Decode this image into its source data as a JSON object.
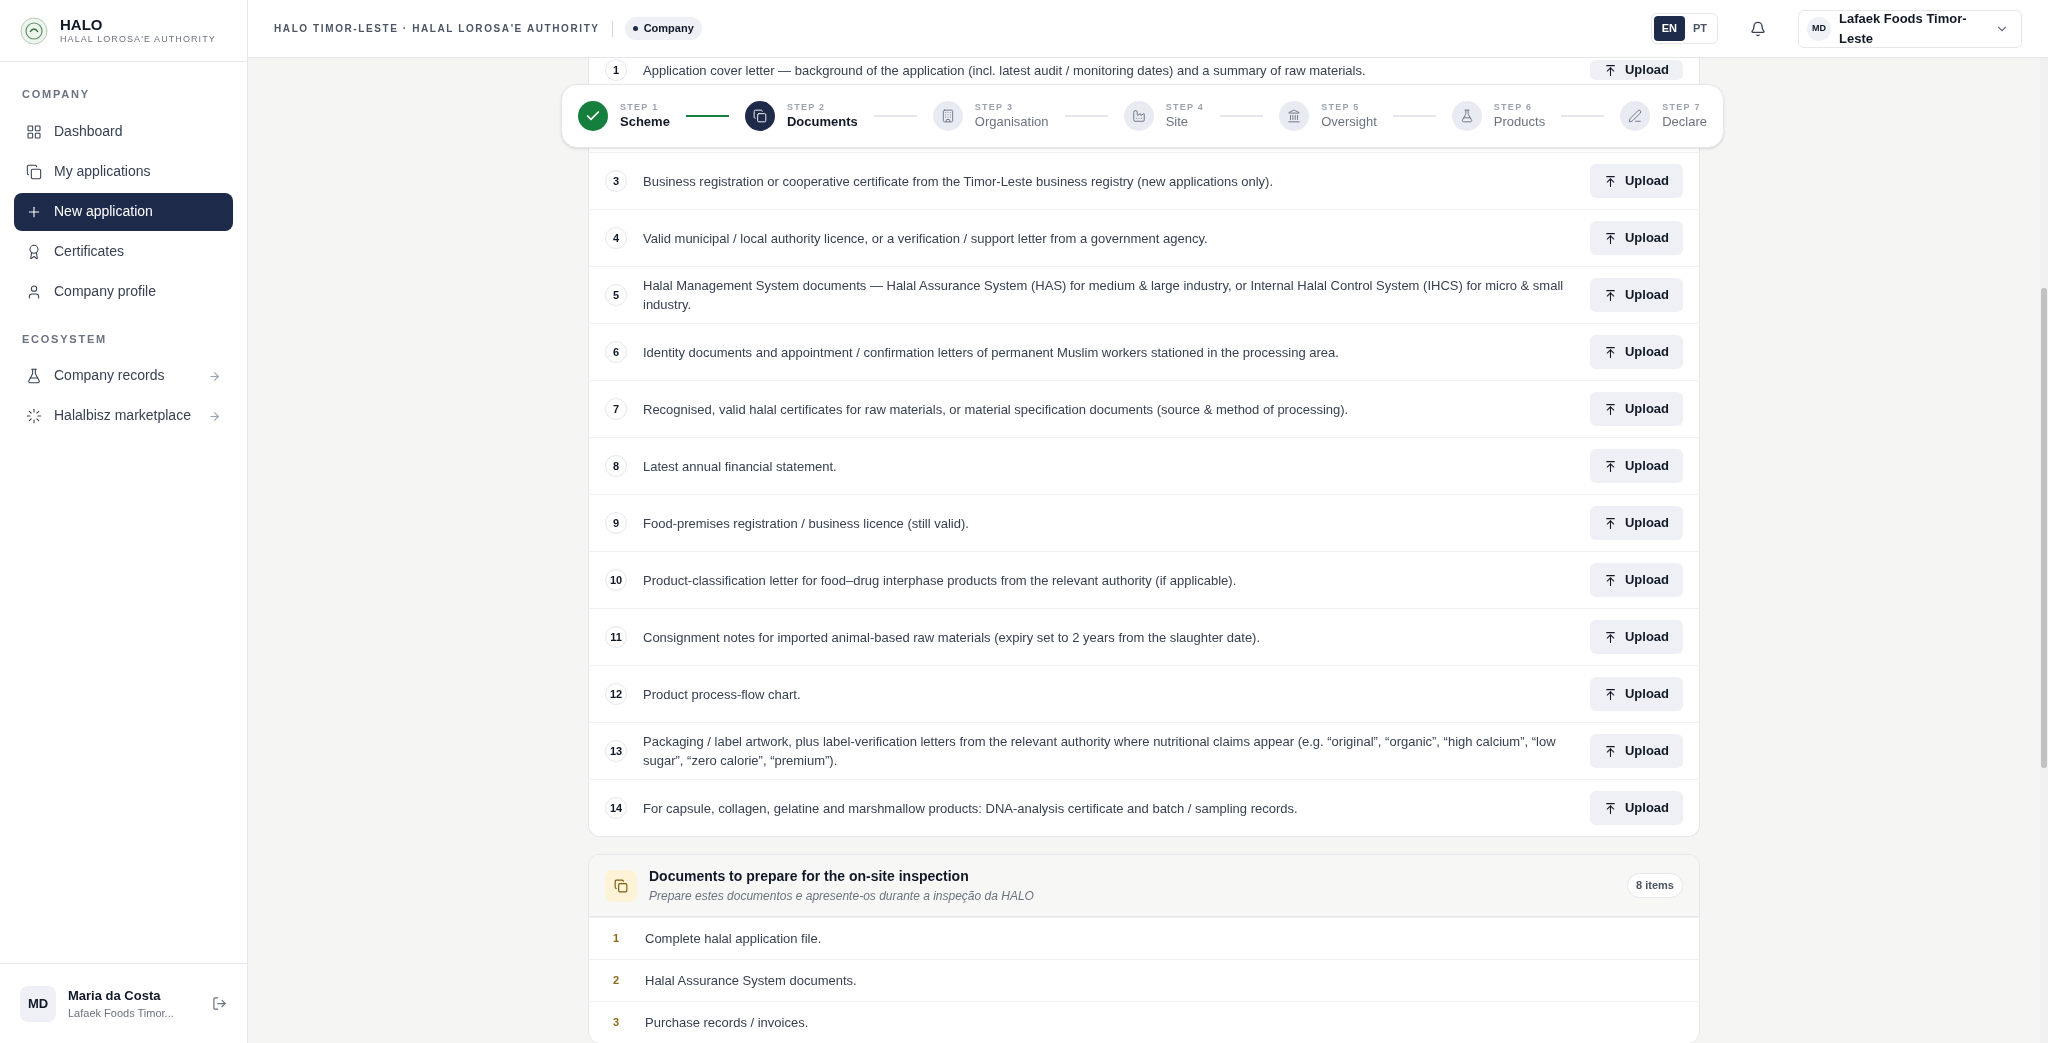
{
  "brand": {
    "title": "HALO",
    "subtitle": "HALAL LOROSA'E AUTHORITY"
  },
  "sidebar": {
    "sections": [
      {
        "heading": "COMPANY",
        "items": [
          {
            "label": "Dashboard",
            "selected": false
          },
          {
            "label": "My applications",
            "selected": false
          },
          {
            "label": "New application",
            "selected": true
          },
          {
            "label": "Certificates",
            "selected": false
          },
          {
            "label": "Company profile",
            "selected": false
          }
        ]
      },
      {
        "heading": "ECOSYSTEM",
        "items": [
          {
            "label": "Company records",
            "selected": false
          },
          {
            "label": "Halalbisz marketplace",
            "selected": false
          }
        ]
      }
    ]
  },
  "user": {
    "initials": "MD",
    "name": "Maria da Costa",
    "company": "Lafaek Foods Timor..."
  },
  "header": {
    "breadcrumb": "HALO TIMOR-LESTE · HALAL LOROSA'E AUTHORITY",
    "context_badge": "Company",
    "languages": [
      {
        "code": "EN",
        "selected": true
      },
      {
        "code": "PT",
        "selected": false
      }
    ],
    "account": {
      "initials": "MD",
      "name": "Lafaek Foods Timor-Leste"
    }
  },
  "steps": [
    {
      "label": "STEP 1",
      "name": "Scheme",
      "completed": true,
      "current": false
    },
    {
      "label": "STEP 2",
      "name": "Documents",
      "completed": false,
      "current": true
    },
    {
      "label": "STEP 3",
      "name": "Organisation",
      "completed": false,
      "current": false
    },
    {
      "label": "STEP 4",
      "name": "Site",
      "completed": false,
      "current": false
    },
    {
      "label": "STEP 5",
      "name": "Oversight",
      "completed": false,
      "current": false
    },
    {
      "label": "STEP 6",
      "name": "Products",
      "completed": false,
      "current": false
    },
    {
      "label": "STEP 7",
      "name": "Declare",
      "completed": false,
      "current": false
    }
  ],
  "required_documents": [
    {
      "number": "1",
      "text": "Application cover letter — background of the application (incl. latest audit / monitoring dates) and a summary of raw materials.",
      "action": "Upload"
    },
    {
      "number": "3",
      "text": "Business registration or cooperative certificate from the Timor-Leste business registry (new applications only).",
      "action": "Upload"
    },
    {
      "number": "4",
      "text": "Valid municipal / local authority licence, or a verification / support letter from a government agency.",
      "action": "Upload"
    },
    {
      "number": "5",
      "text": "Halal Management System documents — Halal Assurance System (HAS) for medium & large industry, or Internal Halal Control System (IHCS) for micro & small industry.",
      "action": "Upload"
    },
    {
      "number": "6",
      "text": "Identity documents and appointment / confirmation letters of permanent Muslim workers stationed in the processing area.",
      "action": "Upload"
    },
    {
      "number": "7",
      "text": "Recognised, valid halal certificates for raw materials, or material specification documents (source & method of processing).",
      "action": "Upload"
    },
    {
      "number": "8",
      "text": "Latest annual financial statement.",
      "action": "Upload"
    },
    {
      "number": "9",
      "text": "Food-premises registration / business licence (still valid).",
      "action": "Upload"
    },
    {
      "number": "10",
      "text": "Product-classification letter for food–drug interphase products from the relevant authority (if applicable).",
      "action": "Upload"
    },
    {
      "number": "11",
      "text": "Consignment notes for imported animal-based raw materials (expiry set to 2 years from the slaughter date).",
      "action": "Upload"
    },
    {
      "number": "12",
      "text": "Product process-flow chart.",
      "action": "Upload"
    },
    {
      "number": "13",
      "text": "Packaging / label artwork, plus label-verification letters from the relevant authority where nutritional claims appear (e.g. “original”, “organic”, “high calcium”, “low sugar”, “zero calorie”, “premium”).",
      "action": "Upload"
    },
    {
      "number": "14",
      "text": "For capsule, collagen, gelatine and marshmallow products: DNA-analysis certificate and batch / sampling records.",
      "action": "Upload"
    }
  ],
  "inspection": {
    "title": "Documents to prepare for the on-site inspection",
    "subtitle": "Prepare estes documentos e apresente-os durante a inspeção da HALO",
    "count": "8 items",
    "items": [
      {
        "number": "1",
        "text": "Complete halal application file."
      },
      {
        "number": "2",
        "text": "Halal Assurance System documents."
      },
      {
        "number": "3",
        "text": "Purchase records / invoices."
      }
    ]
  }
}
